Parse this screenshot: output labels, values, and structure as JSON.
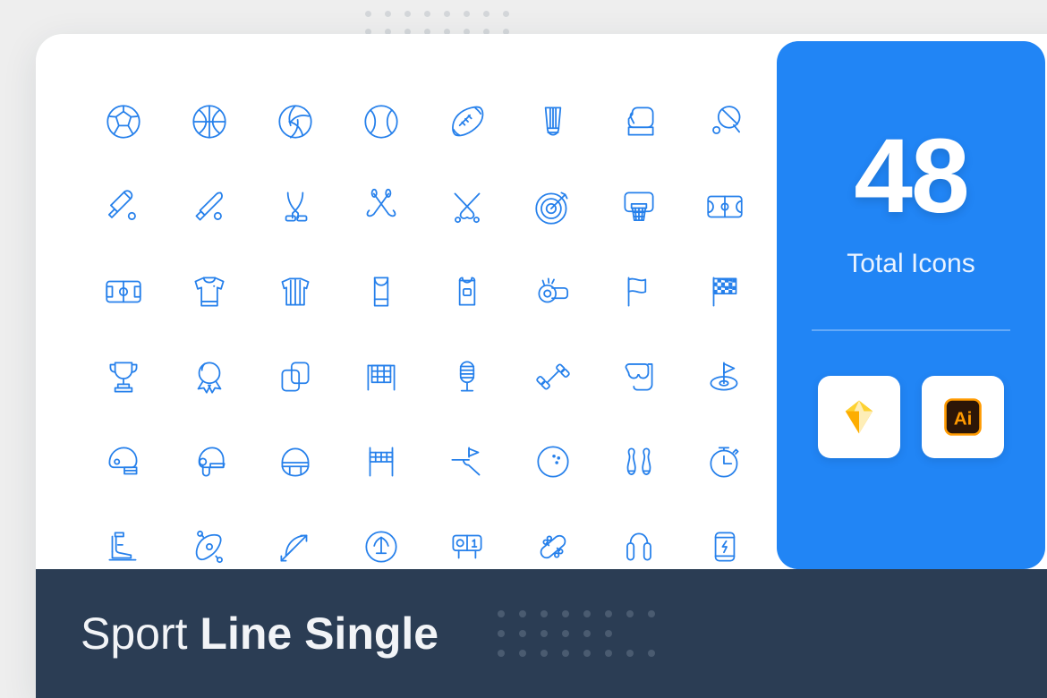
{
  "background": {
    "page_color": "#eeeeee",
    "card_color": "#ffffff"
  },
  "decor": {
    "top_dots": {
      "columns": 8,
      "rows": 2,
      "color": "#d4d7da"
    },
    "banner_dots": {
      "columns": 8,
      "rows": 3,
      "color": "#4a5b70",
      "hidden_cells": [
        14,
        15
      ]
    }
  },
  "stats": {
    "count": "48",
    "label": "Total Icons",
    "accent_color": "#2185f5",
    "formats": [
      {
        "name": "sketch-logo",
        "title": "Sketch"
      },
      {
        "name": "illustrator-logo",
        "title": "Adobe Illustrator"
      }
    ]
  },
  "banner": {
    "title_light": "Sport ",
    "title_bold": "Line Single",
    "background_color": "#2b3d54"
  },
  "icons": {
    "stroke_color": "#2680eb",
    "items": [
      {
        "name": "soccer-ball-icon",
        "label": "Soccer Ball"
      },
      {
        "name": "basketball-icon",
        "label": "Basketball"
      },
      {
        "name": "volleyball-icon",
        "label": "Volleyball"
      },
      {
        "name": "tennis-ball-icon",
        "label": "Tennis Ball"
      },
      {
        "name": "football-icon",
        "label": "American Football"
      },
      {
        "name": "shuttlecock-icon",
        "label": "Shuttlecock"
      },
      {
        "name": "boxing-glove-icon",
        "label": "Boxing Glove"
      },
      {
        "name": "ping-pong-paddle-icon",
        "label": "Ping Pong Paddle"
      },
      {
        "name": "cricket-bat-icon",
        "label": "Cricket Bat"
      },
      {
        "name": "baseball-bat-icon",
        "label": "Baseball Bat"
      },
      {
        "name": "hockey-sticks-icon",
        "label": "Hockey Sticks"
      },
      {
        "name": "golf-clubs-icon",
        "label": "Golf Clubs"
      },
      {
        "name": "fencing-swords-icon",
        "label": "Fencing Swords"
      },
      {
        "name": "dartboard-icon",
        "label": "Dartboard"
      },
      {
        "name": "basketball-hoop-icon",
        "label": "Basketball Hoop"
      },
      {
        "name": "basketball-court-icon",
        "label": "Basketball Court"
      },
      {
        "name": "soccer-field-icon",
        "label": "Soccer Field"
      },
      {
        "name": "jersey-icon",
        "label": "Jersey"
      },
      {
        "name": "referee-shirt-icon",
        "label": "Referee Shirt"
      },
      {
        "name": "tank-top-icon",
        "label": "Tank Top"
      },
      {
        "name": "numbered-bib-icon",
        "label": "Numbered Bib"
      },
      {
        "name": "whistle-icon",
        "label": "Whistle"
      },
      {
        "name": "flag-icon",
        "label": "Flag"
      },
      {
        "name": "checkered-flag-icon",
        "label": "Checkered Flag"
      },
      {
        "name": "trophy-icon",
        "label": "Trophy"
      },
      {
        "name": "medal-icon",
        "label": "Medal"
      },
      {
        "name": "penalty-cards-icon",
        "label": "Penalty Cards"
      },
      {
        "name": "goal-net-icon",
        "label": "Goal Net"
      },
      {
        "name": "microphone-icon",
        "label": "Microphone"
      },
      {
        "name": "dumbbell-icon",
        "label": "Dumbbell"
      },
      {
        "name": "snorkel-mask-icon",
        "label": "Snorkel Mask"
      },
      {
        "name": "golf-hole-flag-icon",
        "label": "Golf Hole Flag"
      },
      {
        "name": "football-helmet-icon",
        "label": "Football Helmet"
      },
      {
        "name": "baseball-helmet-icon",
        "label": "Baseball Helmet"
      },
      {
        "name": "sports-helmet-icon",
        "label": "Sports Helmet"
      },
      {
        "name": "volleyball-net-icon",
        "label": "Volleyball Net"
      },
      {
        "name": "golf-green-flag-icon",
        "label": "Golf Green Flag"
      },
      {
        "name": "bowling-ball-icon",
        "label": "Bowling Ball"
      },
      {
        "name": "bowling-pins-icon",
        "label": "Bowling Pins"
      },
      {
        "name": "stopwatch-icon",
        "label": "Stopwatch"
      },
      {
        "name": "ice-skate-icon",
        "label": "Ice Skate"
      },
      {
        "name": "kayak-icon",
        "label": "Kayak"
      },
      {
        "name": "bow-and-arrow-icon",
        "label": "Bow and Arrow"
      },
      {
        "name": "golf-tee-icon",
        "label": "Golf Ball on Tee"
      },
      {
        "name": "scoreboard-icon",
        "label": "Scoreboard"
      },
      {
        "name": "skateboard-icon",
        "label": "Skateboard"
      },
      {
        "name": "jump-rope-icon",
        "label": "Jump Rope"
      },
      {
        "name": "energy-drink-icon",
        "label": "Energy Drink"
      }
    ]
  }
}
